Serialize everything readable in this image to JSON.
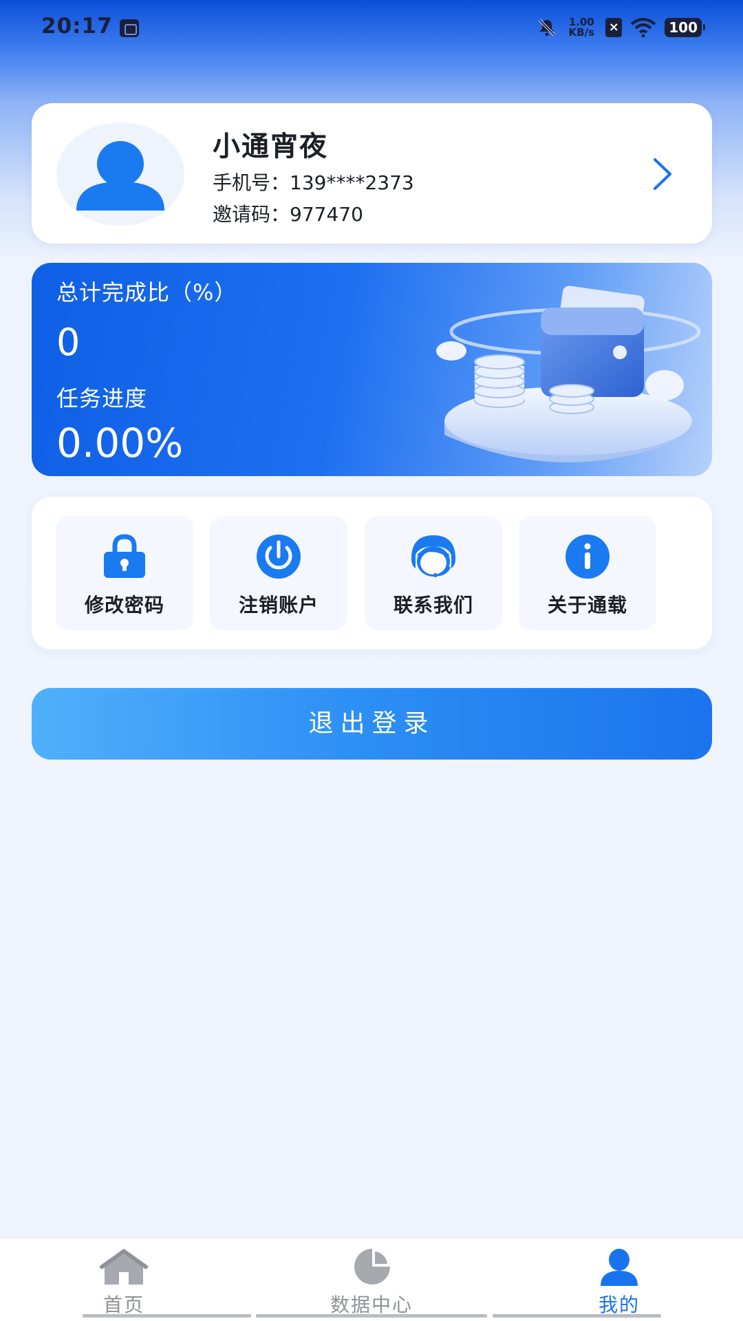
{
  "status_bar": {
    "time": "20:17",
    "net_speed_value": "1.00",
    "net_speed_unit": "KB/s",
    "battery": "100",
    "icons": [
      "app-notification-icon",
      "bell-muted-icon",
      "close-box-icon",
      "wifi-icon",
      "battery-icon"
    ]
  },
  "profile": {
    "name": "小通宵夜",
    "phone_label": "手机号：",
    "phone": "139****2373",
    "invite_label": "邀请码：",
    "invite_code": "977470"
  },
  "stats": {
    "total_label": "总计完成比（%）",
    "total_value": "0",
    "progress_label": "任务进度",
    "progress_value": "0.00%"
  },
  "actions": [
    {
      "label": "修改密码",
      "icon": "lock-icon"
    },
    {
      "label": "注销账户",
      "icon": "power-icon"
    },
    {
      "label": "联系我们",
      "icon": "customer-service-icon"
    },
    {
      "label": "关于通载",
      "icon": "info-icon"
    }
  ],
  "logout_label": "退出登录",
  "tabs": [
    {
      "label": "首页",
      "icon": "home-icon",
      "active": false
    },
    {
      "label": "数据中心",
      "icon": "pie-chart-icon",
      "active": false
    },
    {
      "label": "我的",
      "icon": "user-icon",
      "active": true
    }
  ],
  "colors": {
    "accent": "#1a73ee",
    "inactive": "#8e9196",
    "background": "#eff4fd"
  }
}
